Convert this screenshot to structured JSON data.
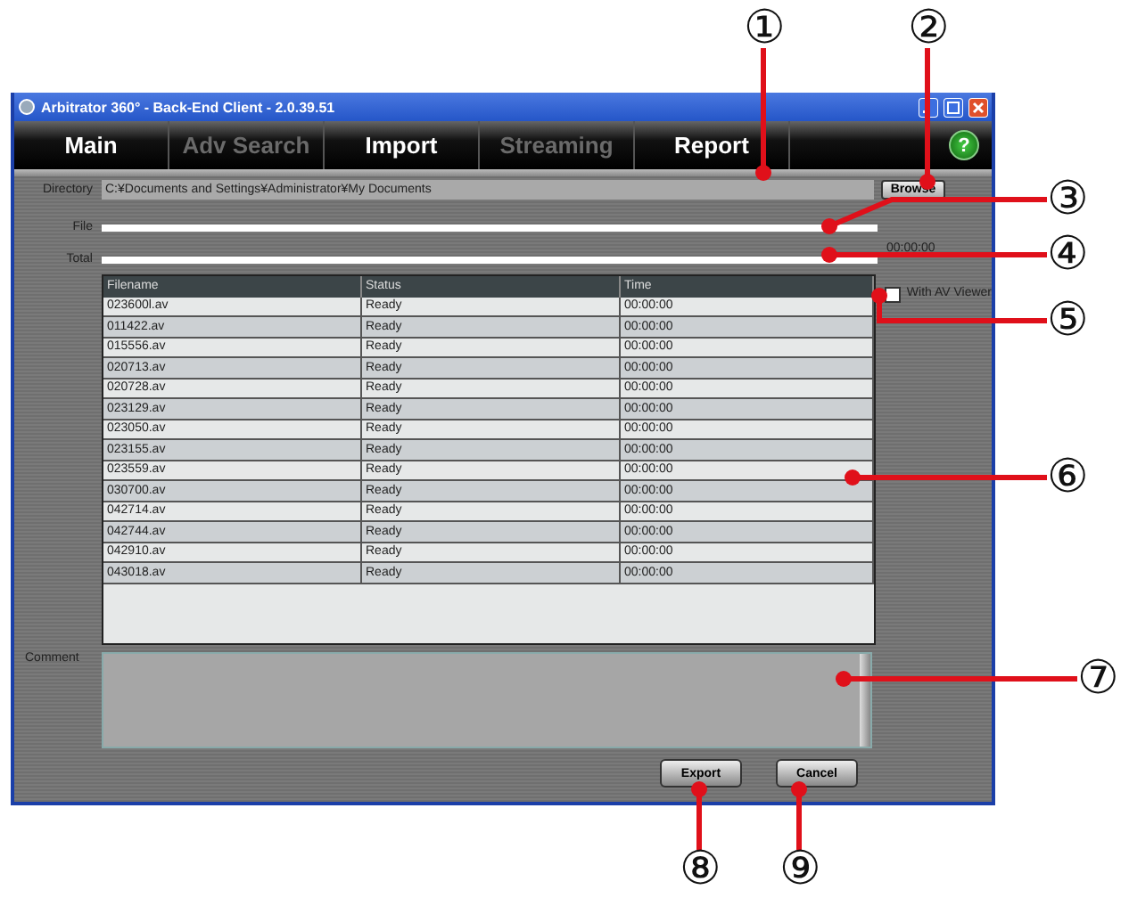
{
  "window": {
    "title": "Arbitrator 360° - Back-End Client - 2.0.39.51"
  },
  "tabs": [
    {
      "label": "Main",
      "disabled": false
    },
    {
      "label": "Adv Search",
      "disabled": true
    },
    {
      "label": "Import",
      "disabled": false
    },
    {
      "label": "Streaming",
      "disabled": true
    },
    {
      "label": "Report",
      "disabled": false
    }
  ],
  "help_button": {
    "label": "?"
  },
  "directory": {
    "label": "Directory",
    "value": "C:¥Documents and Settings¥Administrator¥My Documents",
    "button": "Browse"
  },
  "file_progress": {
    "label": "File",
    "level": 0
  },
  "total_progress": {
    "label": "Total",
    "level": 0,
    "reading": "00:00:00"
  },
  "table": {
    "columns": [
      "Filename",
      "Status",
      "Time"
    ],
    "rows": [
      [
        "023600l.av",
        "Ready",
        "00:00:00"
      ],
      [
        "011422.av",
        "Ready",
        "00:00:00"
      ],
      [
        "015556.av",
        "Ready",
        "00:00:00"
      ],
      [
        "020713.av",
        "Ready",
        "00:00:00"
      ],
      [
        "020728.av",
        "Ready",
        "00:00:00"
      ],
      [
        "023129.av",
        "Ready",
        "00:00:00"
      ],
      [
        "023050.av",
        "Ready",
        "00:00:00"
      ],
      [
        "023155.av",
        "Ready",
        "00:00:00"
      ],
      [
        "023559.av",
        "Ready",
        "00:00:00"
      ],
      [
        "030700.av",
        "Ready",
        "00:00:00"
      ],
      [
        "042714.av",
        "Ready",
        "00:00:00"
      ],
      [
        "042744.av",
        "Ready",
        "00:00:00"
      ],
      [
        "042910.av",
        "Ready",
        "00:00:00"
      ],
      [
        "043018.av",
        "Ready",
        "00:00:00"
      ]
    ]
  },
  "av_viewer": {
    "label": "With AV Viewer",
    "checked": false
  },
  "comment": {
    "label": "Comment"
  },
  "buttons": [
    "Export",
    "Cancel"
  ],
  "callouts": [
    {
      "number": "①"
    },
    {
      "number": "②"
    },
    {
      "number": "③"
    },
    {
      "number": "④"
    },
    {
      "number": "⑤"
    },
    {
      "number": "⑥"
    },
    {
      "number": "⑦"
    },
    {
      "number": "⑧"
    },
    {
      "number": "⑨"
    }
  ]
}
